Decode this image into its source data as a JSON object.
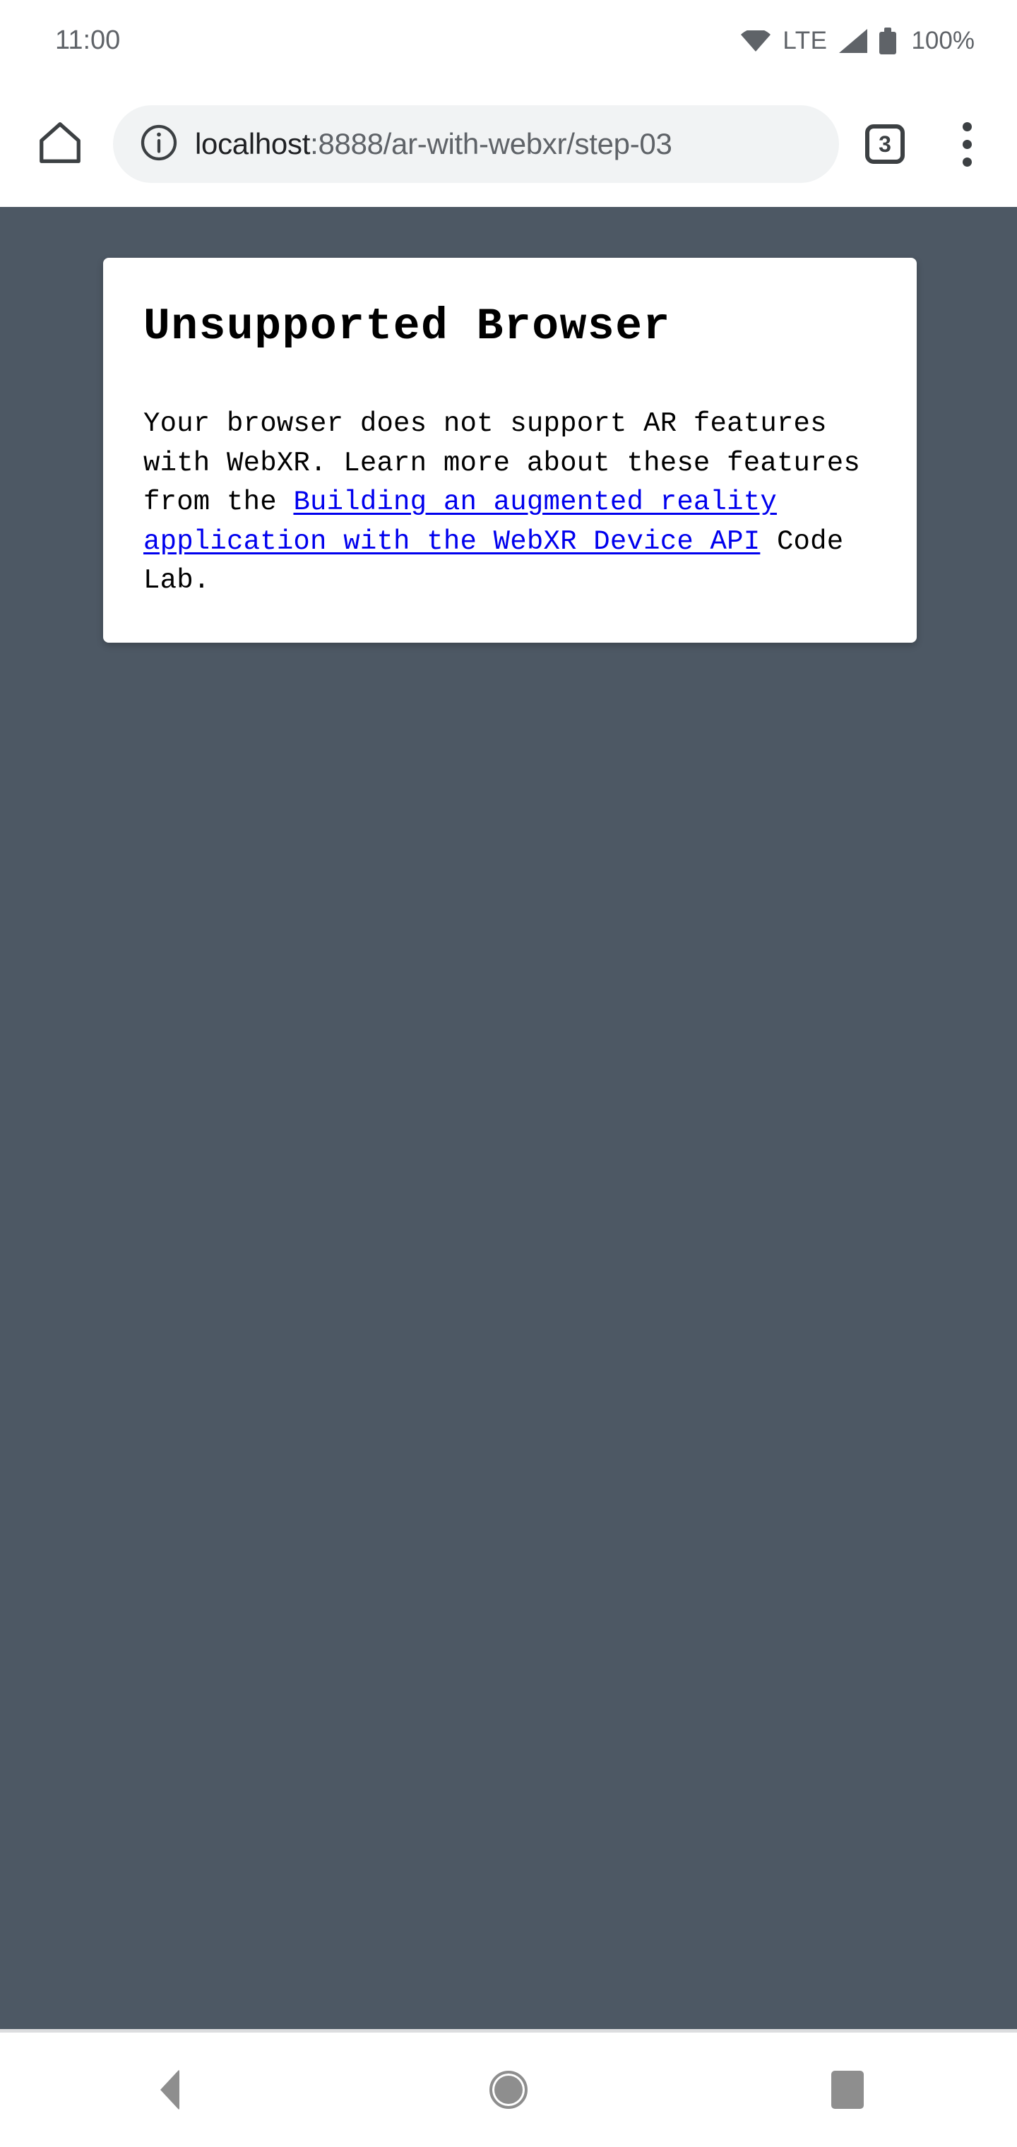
{
  "status_bar": {
    "clock": "11:00",
    "network_label": "LTE",
    "battery_percent": "100%",
    "icons": {
      "wifi": "wifi-icon",
      "signal": "cellular-signal-icon",
      "battery": "battery-icon"
    },
    "icon_color": "#5f6368"
  },
  "browser_toolbar": {
    "home_icon": "home-icon",
    "site_info_icon": "info-circle-icon",
    "url_host": "localhost",
    "url_rest": ":8888/ar-with-webxr/step-03",
    "url_full": "localhost:8888/ar-with-webxr/step-03",
    "tab_count": "3",
    "menu_icon": "overflow-menu-icon",
    "omnibox_background": "#f1f3f4",
    "host_color": "#202124",
    "path_color": "#5f6368"
  },
  "page": {
    "background_color": "#4d5864",
    "card": {
      "title": "Unsupported Browser",
      "body_before_link": "Your browser does not support AR features with WebXR. Learn more about these features from the ",
      "link_text": "Building an augmented reality application with the WebXR Device API",
      "body_after_link": " Code Lab.",
      "link_color": "#0000ee",
      "text_color": "#000000",
      "background_color": "#ffffff"
    }
  },
  "nav_bar": {
    "back_icon": "back-triangle-icon",
    "home_icon": "home-circle-icon",
    "recents_icon": "recents-square-icon",
    "icon_color": "#8e8e8e",
    "background_color": "#ffffff"
  }
}
